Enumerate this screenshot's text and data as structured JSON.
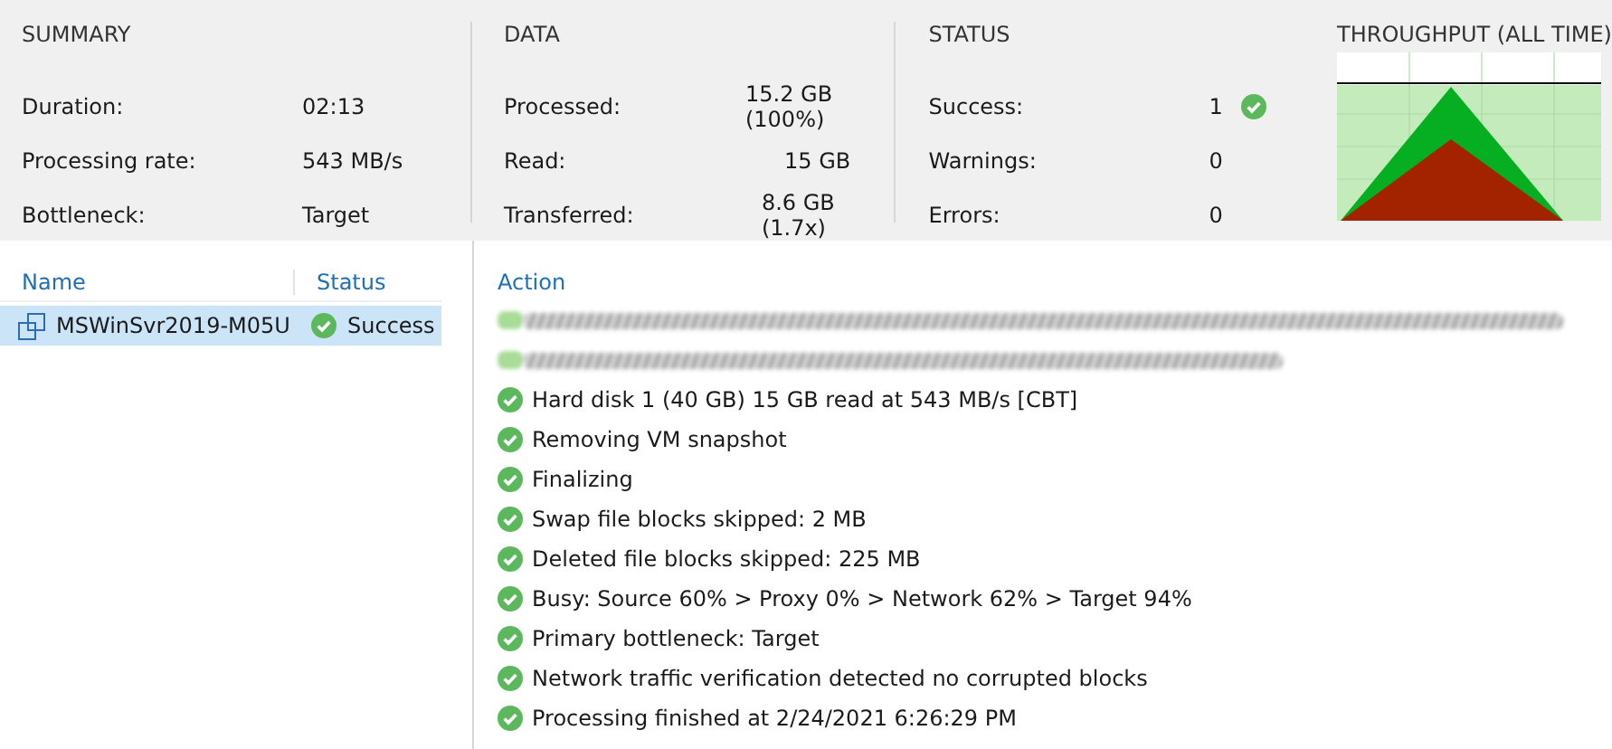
{
  "sections": [
    {
      "title": "SUMMARY",
      "rows": [
        {
          "label": "Duration:",
          "value": "02:13"
        },
        {
          "label": "Processing rate:",
          "value": "543 MB/s"
        },
        {
          "label": "Bottleneck:",
          "value": "Target"
        }
      ]
    },
    {
      "title": "DATA",
      "rows": [
        {
          "label": "Processed:",
          "value": "15.2 GB (100%)"
        },
        {
          "label": "Read:",
          "value": "15 GB"
        },
        {
          "label": "Transferred:",
          "value": "8.6 GB (1.7x)"
        }
      ]
    },
    {
      "title": "STATUS",
      "rows": [
        {
          "label": "Success:",
          "value": "1",
          "kind": "success"
        },
        {
          "label": "Warnings:",
          "value": "0"
        },
        {
          "label": "Errors:",
          "value": "0"
        }
      ]
    }
  ],
  "throughput": {
    "title": "THROUGHPUT (ALL TIME)"
  },
  "sessions": {
    "columns": [
      "Name",
      "Status"
    ],
    "rows": [
      {
        "name": "MSWinSvr2019-M05U",
        "status": "Success",
        "selected": true
      }
    ]
  },
  "actions": {
    "column": "Action",
    "items": [
      {
        "kind": "redacted"
      },
      {
        "kind": "redacted"
      },
      {
        "kind": "success",
        "text": "Hard disk 1 (40 GB) 15 GB read at 543 MB/s [CBT]"
      },
      {
        "kind": "success",
        "text": "Removing VM snapshot"
      },
      {
        "kind": "success",
        "text": "Finalizing"
      },
      {
        "kind": "success",
        "text": "Swap file blocks skipped: 2 MB"
      },
      {
        "kind": "success",
        "text": "Deleted file blocks skipped: 225 MB"
      },
      {
        "kind": "success",
        "text": "Busy: Source 60% > Proxy 0% > Network 62% > Target 94%"
      },
      {
        "kind": "success",
        "text": "Primary bottleneck: Target"
      },
      {
        "kind": "success",
        "text": "Network traffic verification detected no corrupted blocks"
      },
      {
        "kind": "success",
        "text": "Processing finished at 2/24/2021 6:26:29 PM"
      }
    ]
  }
}
